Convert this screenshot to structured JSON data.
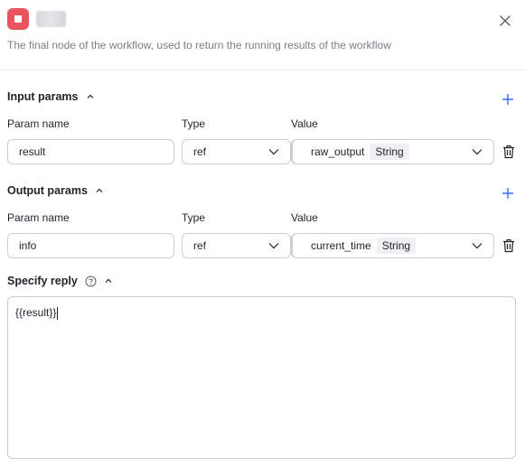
{
  "header": {
    "description": "The final node of the workflow, used to return the running results of the workflow",
    "icon": "stop-square-icon",
    "accent_color": "#e8555f"
  },
  "input_params": {
    "title": "Input params",
    "columns": {
      "name": "Param name",
      "type": "Type",
      "value": "Value"
    },
    "rows": [
      {
        "name": "result",
        "type": "ref",
        "value": "raw_output",
        "value_type": "String"
      }
    ]
  },
  "output_params": {
    "title": "Output params",
    "columns": {
      "name": "Param name",
      "type": "Type",
      "value": "Value"
    },
    "rows": [
      {
        "name": "info",
        "type": "ref",
        "value": "current_time",
        "value_type": "String"
      }
    ]
  },
  "reply": {
    "title": "Specify reply",
    "content": "{{result}}"
  },
  "colors": {
    "add_icon": "#3370ff",
    "border": "#c9cdd4",
    "muted_text": "#7a7f87"
  }
}
